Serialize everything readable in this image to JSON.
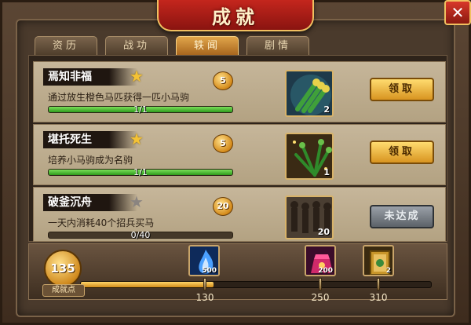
{
  "window": {
    "title": "成就",
    "close_label": "✕"
  },
  "tabs": [
    {
      "label": "资历",
      "active": false
    },
    {
      "label": "战功",
      "active": false
    },
    {
      "label": "轶闻",
      "active": true
    },
    {
      "label": "剧情",
      "active": false
    }
  ],
  "achievements": [
    {
      "name": "焉知非福",
      "star_color": "#f4c235",
      "reward_points": "5",
      "description": "通过放生橙色马匹获得一匹小马驹",
      "progress_text": "1/1",
      "progress_fraction": 1.0,
      "item_icon": "bamboo-shoot-icon",
      "item_count": "2",
      "button_label": "领取",
      "button_state": "claimable"
    },
    {
      "name": "堪托死生",
      "star_color": "#f4c235",
      "reward_points": "5",
      "description": "培养小马驹成为名驹",
      "progress_text": "1/1",
      "progress_fraction": 1.0,
      "item_icon": "green-herb-icon",
      "item_count": "1",
      "button_label": "领取",
      "button_state": "claimable"
    },
    {
      "name": "破釜沉舟",
      "star_color": "#8a8480",
      "reward_points": "20",
      "description": "一天内消耗40个招兵买马",
      "progress_text": "0/40",
      "progress_fraction": 0.0,
      "item_icon": "soldiers-icon",
      "item_count": "20",
      "button_label": "未达成",
      "button_state": "locked"
    }
  ],
  "points": {
    "value": "135",
    "label": "成就点"
  },
  "milestones": [
    {
      "threshold": "130",
      "icon": "blue-flame-icon",
      "count": "500",
      "reached": true
    },
    {
      "threshold": "250",
      "icon": "red-pouch-icon",
      "count": "200",
      "reached": false
    },
    {
      "threshold": "310",
      "icon": "gold-book-icon",
      "count": "2",
      "reached": false
    }
  ],
  "track_progress_fraction": 0.38
}
